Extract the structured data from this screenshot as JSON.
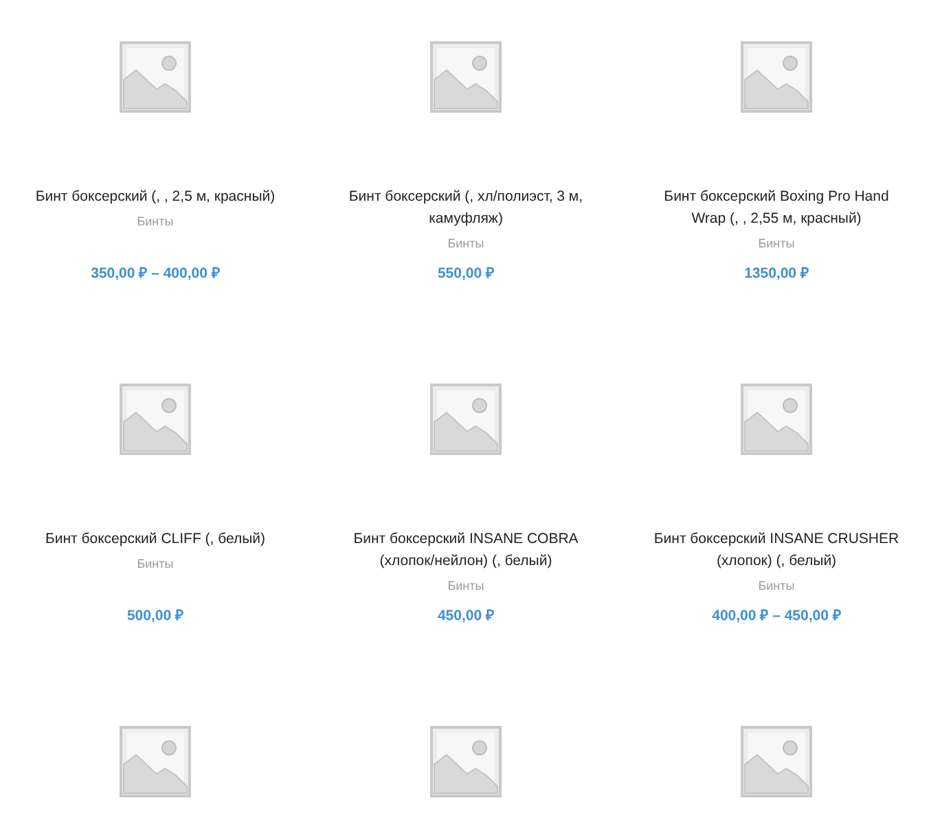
{
  "products": [
    {
      "kind": "product",
      "title": "Бинт боксерский (, , 2,5 м, красный)",
      "category": "Бинты",
      "price": "350,00 ₽ – 400,00 ₽"
    },
    {
      "kind": "product",
      "title": "Бинт боксерский (, хл/полиэст, 3 м, камуфляж)",
      "category": "Бинты",
      "price": "550,00 ₽"
    },
    {
      "kind": "product",
      "title": "Бинт боксерский Boxing Pro Hand Wrap (, , 2,55 м, красный)",
      "category": "Бинты",
      "price": "1350,00 ₽"
    },
    {
      "kind": "product",
      "title": "Бинт боксерский CLIFF (, белый)",
      "category": "Бинты",
      "price": "500,00 ₽"
    },
    {
      "kind": "product",
      "title": "Бинт боксерский INSANE COBRA (хлопок/нейлон) (, белый)",
      "category": "Бинты",
      "price": "450,00 ₽"
    },
    {
      "kind": "product",
      "title": "Бинт боксерский INSANE CRUSHER (хлопок) (, белый)",
      "category": "Бинты",
      "price": "400,00 ₽ – 450,00 ₽"
    },
    {
      "kind": "product"
    },
    {
      "kind": "product"
    },
    {
      "kind": "product"
    }
  ]
}
